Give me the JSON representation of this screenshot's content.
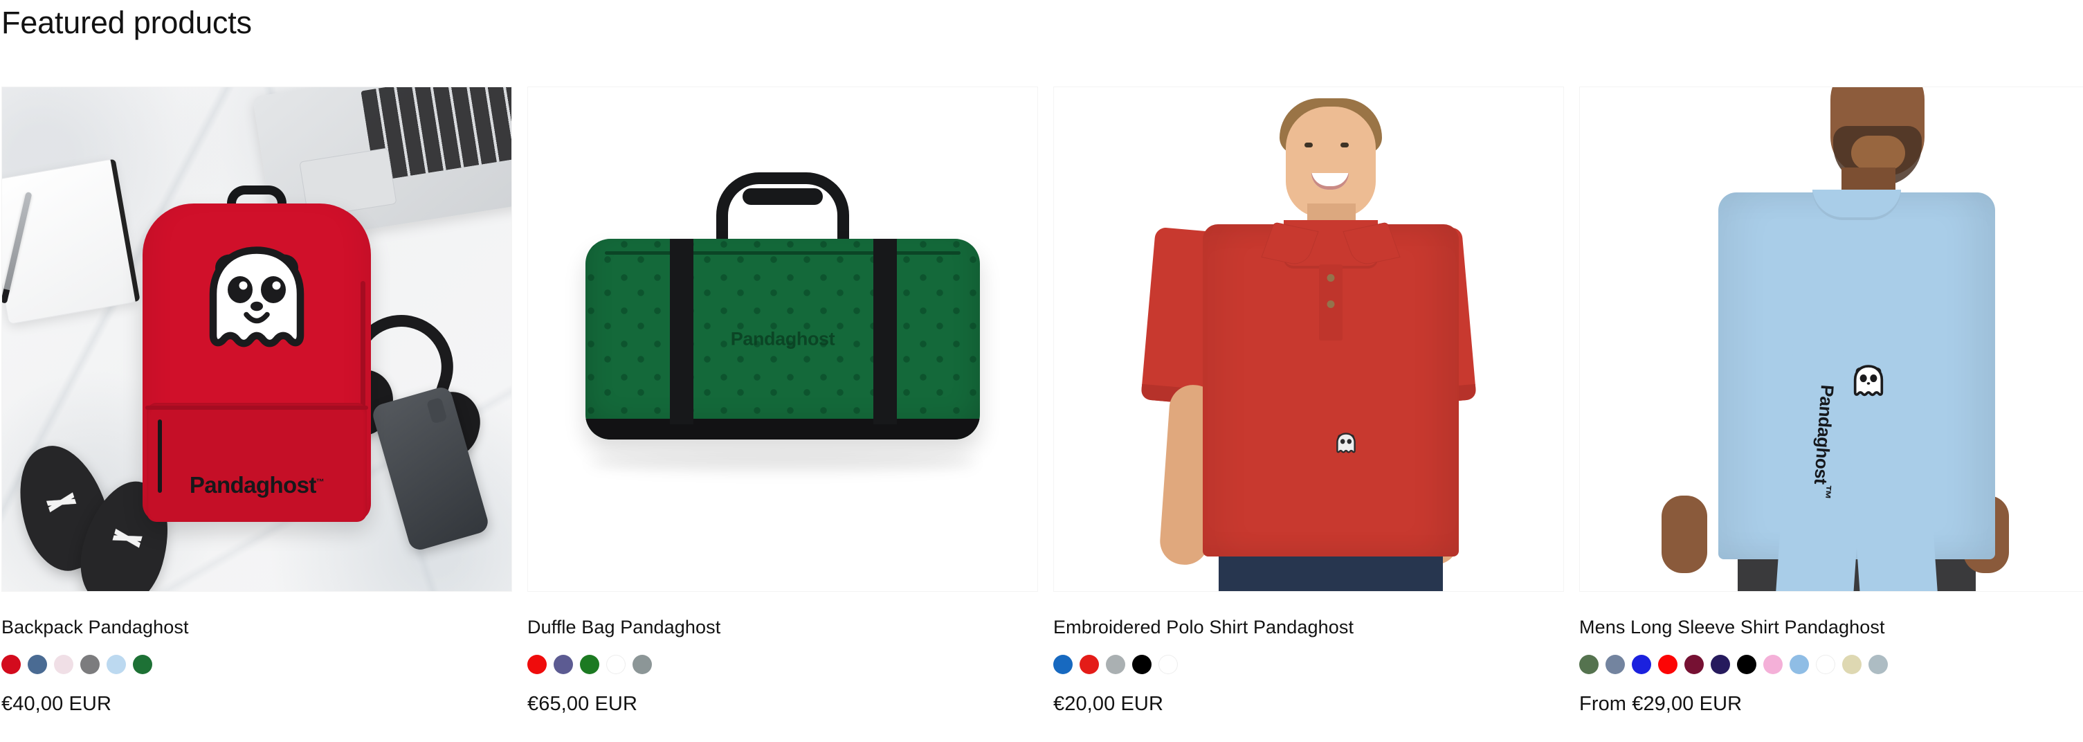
{
  "section": {
    "heading": "Featured products"
  },
  "products": [
    {
      "title": "Backpack Pandaghost",
      "price": "€40,00 EUR",
      "image_alt": "red-backpack-flatlay",
      "brand_mark": "Pandaghost",
      "brand_mark_tm": "™",
      "swatches": [
        {
          "name": "red",
          "hex": "#d30b1d"
        },
        {
          "name": "steel-blue",
          "hex": "#4a6b93"
        },
        {
          "name": "light-pink",
          "hex": "#f0dfe6"
        },
        {
          "name": "grey",
          "hex": "#7c7c7e"
        },
        {
          "name": "light-blue",
          "hex": "#bcd9f0"
        },
        {
          "name": "green",
          "hex": "#1d7135"
        }
      ]
    },
    {
      "title": "Duffle Bag Pandaghost",
      "price": "€65,00 EUR",
      "image_alt": "green-duffle-bag",
      "brand_mark": "Pandaghost",
      "brand_mark_tm": "",
      "swatches": [
        {
          "name": "red",
          "hex": "#ef0c0c"
        },
        {
          "name": "slate-purple",
          "hex": "#5c5b92"
        },
        {
          "name": "green",
          "hex": "#1c7a22"
        },
        {
          "name": "white",
          "hex": "#ffffff"
        },
        {
          "name": "grey",
          "hex": "#8c9697"
        }
      ]
    },
    {
      "title": "Embroidered Polo Shirt Pandaghost",
      "price": "€20,00 EUR",
      "image_alt": "man-wearing-red-polo-shirt",
      "brand_mark": "",
      "brand_mark_tm": "",
      "swatches": [
        {
          "name": "royal-blue",
          "hex": "#1769c0"
        },
        {
          "name": "red",
          "hex": "#e41c18"
        },
        {
          "name": "light-grey",
          "hex": "#aab0b2"
        },
        {
          "name": "black",
          "hex": "#000000"
        },
        {
          "name": "white",
          "hex": "#ffffff"
        }
      ]
    },
    {
      "title": "Mens Long Sleeve Shirt Pandaghost",
      "price": "From €29,00 EUR",
      "image_alt": "man-wearing-light-blue-long-sleeve-shirt",
      "brand_mark": "Pandaghost",
      "brand_mark_tm": "™",
      "swatches": [
        {
          "name": "military-green",
          "hex": "#55734f"
        },
        {
          "name": "slate-blue",
          "hex": "#73849f"
        },
        {
          "name": "blue",
          "hex": "#1b21de"
        },
        {
          "name": "red",
          "hex": "#fc0505"
        },
        {
          "name": "maroon",
          "hex": "#761133"
        },
        {
          "name": "navy",
          "hex": "#261a5d"
        },
        {
          "name": "black",
          "hex": "#000000"
        },
        {
          "name": "pink",
          "hex": "#f4b0d8"
        },
        {
          "name": "light-blue",
          "hex": "#8fbde5"
        },
        {
          "name": "white",
          "hex": "#ffffff"
        },
        {
          "name": "khaki",
          "hex": "#ded8b2"
        },
        {
          "name": "light-grey-blue",
          "hex": "#adbcc3"
        }
      ]
    }
  ]
}
